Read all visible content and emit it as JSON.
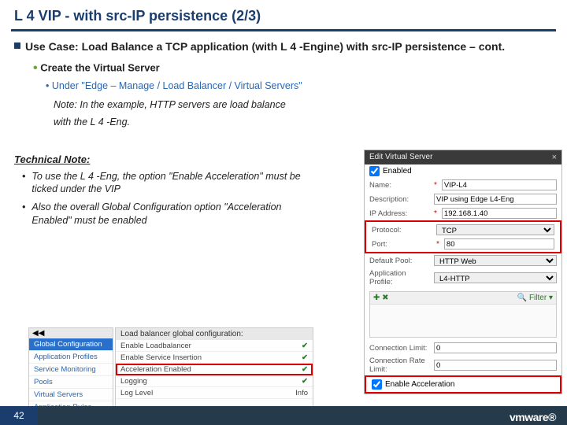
{
  "title": "L 4 VIP - with src-IP persistence (2/3)",
  "useCase": "Use Case: Load Balance a TCP application (with L 4 -Engine) with src-IP persistence – cont.",
  "sub1": "Create the Virtual Server",
  "sub2": "Under \"Edge – Manage /  Load Balancer / Virtual Servers\"",
  "noteItalic1": "Note: In the example, HTTP servers are load balance",
  "noteItalic2": "with the L 4 -Eng.",
  "techHead": "Technical Note:",
  "techB1": "To use the L 4 -Eng, the option \"Enable Acceleration\" must be ticked under the VIP",
  "techB2": "Also the overall Global Configuration option \"Acceleration Enabled\" must be enabled",
  "dialog": {
    "title": "Edit Virtual Server",
    "enabled": "Enabled",
    "nameLbl": "Name:",
    "nameVal": "VIP-L4",
    "descLbl": "Description:",
    "descVal": "VIP using Edge L4-Eng",
    "ipLbl": "IP Address:",
    "ipVal": "192.168.1.40",
    "protoLbl": "Protocol:",
    "protoVal": "TCP",
    "portLbl": "Port:",
    "portVal": "80",
    "dpoolLbl": "Default Pool:",
    "dpoolVal": "HTTP Web",
    "appLbl": "Application Profile:",
    "appVal": "L4-HTTP",
    "filter": "Filter",
    "connLbl": "Connection Limit:",
    "connVal": "0",
    "rateLbl": "Connection Rate Limit:",
    "rateVal": "0",
    "accel": "Enable Acceleration"
  },
  "nav": {
    "back": "◀◀",
    "sel": "Global Configuration",
    "items": [
      "Application Profiles",
      "Service Monitoring",
      "Pools",
      "Virtual Servers",
      "Application Rules"
    ]
  },
  "cfg": {
    "head": "Load balancer global configuration:",
    "rows": [
      {
        "k": "Enable Loadbalancer",
        "v": "✔"
      },
      {
        "k": "Enable Service Insertion",
        "v": "✔"
      },
      {
        "k": "Acceleration Enabled",
        "v": "✔",
        "hl": true
      },
      {
        "k": "Logging",
        "v": "✔"
      },
      {
        "k": "Log Level",
        "v": "Info"
      }
    ]
  },
  "pageNum": "42",
  "logo": "vmware"
}
